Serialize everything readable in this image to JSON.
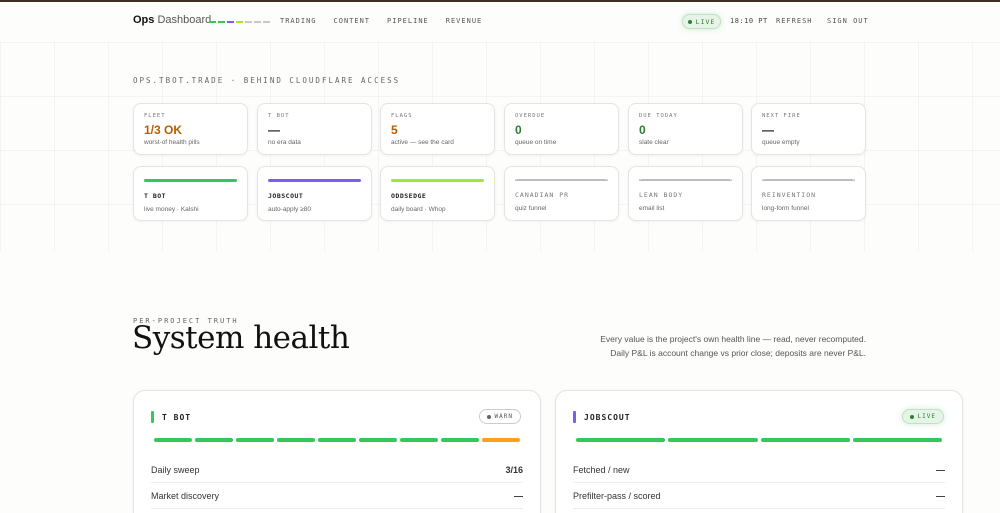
{
  "brand": {
    "bold": "Ops",
    "rest": "Dashboard",
    "bar_colors": [
      "#34c759",
      "#34c759",
      "#7c5cf5",
      "#a3e635",
      "#c7c7c7",
      "#c7c7c7",
      "#c7c7c7"
    ]
  },
  "nav": [
    "TRADING",
    "CONTENT",
    "PIPELINE",
    "REVENUE"
  ],
  "status": {
    "live": "LIVE",
    "time": "18:10 PT",
    "refresh": "REFRESH",
    "signout": "SIGN OUT"
  },
  "site_label": "OPS.TBOT.TRADE · BEHIND CLOUDFLARE ACCESS",
  "stats": [
    {
      "label": "FLEET",
      "value": "1/3 OK",
      "sub": "worst-of health pills",
      "color": "#b65f00"
    },
    {
      "label": "T BOT",
      "value": "—",
      "sub": "no era data",
      "color": "#222222"
    },
    {
      "label": "FLAGS",
      "value": "5",
      "sub": "active — see the card",
      "color": "#b65f00"
    },
    {
      "label": "OVERDUE",
      "value": "0",
      "sub": "queue on time",
      "color": "#2e7d32"
    },
    {
      "label": "DUE TODAY",
      "value": "0",
      "sub": "slate clear",
      "color": "#2e7d32"
    },
    {
      "label": "NEXT FIRE",
      "value": "—",
      "sub": "queue empty",
      "color": "#222222"
    }
  ],
  "projects": [
    {
      "name": "T BOT",
      "sub": "live money · Kalshi",
      "bar": "#34c759",
      "active": true
    },
    {
      "name": "JOBSCOUT",
      "sub": "auto-apply ≥80",
      "bar": "#7c5cf5",
      "active": true
    },
    {
      "name": "ODDSEDGE",
      "sub": "daily board · Whop",
      "bar": "#a3e635",
      "active": true
    },
    {
      "name": "CANADIAN PR",
      "sub": "quiz funnel",
      "bar": "",
      "active": false
    },
    {
      "name": "LEAN BODY",
      "sub": "email list",
      "bar": "",
      "active": false
    },
    {
      "name": "REINVENTION",
      "sub": "long-form funnel",
      "bar": "",
      "active": false
    }
  ],
  "section": {
    "eyebrow": "PER-PROJECT TRUTH",
    "title": "System health",
    "intro_1": "Every value is the project's own health line — read, never recomputed.",
    "intro_2": "Daily P&L is account change vs prior close; deposits are never P&L."
  },
  "health": [
    {
      "name": "T BOT",
      "tick": "#34c759",
      "badge": "WARN",
      "badge_kind": "warn",
      "segments": [
        "#34c759",
        "#34c759",
        "#34c759",
        "#34c759",
        "#34c759",
        "#34c759",
        "#34c759",
        "#34c759",
        "#ff9f1c"
      ],
      "rows": [
        {
          "label": "Daily sweep",
          "value": "3/16"
        },
        {
          "label": "Market discovery",
          "value": "—"
        }
      ]
    },
    {
      "name": "JOBSCOUT",
      "tick": "#7c5cf5",
      "badge": "LIVE",
      "badge_kind": "live",
      "segments": [
        "#34c759",
        "#34c759",
        "#34c759",
        "#34c759"
      ],
      "rows": [
        {
          "label": "Fetched / new",
          "value": "—"
        },
        {
          "label": "Prefilter-pass / scored",
          "value": "—"
        }
      ]
    }
  ]
}
